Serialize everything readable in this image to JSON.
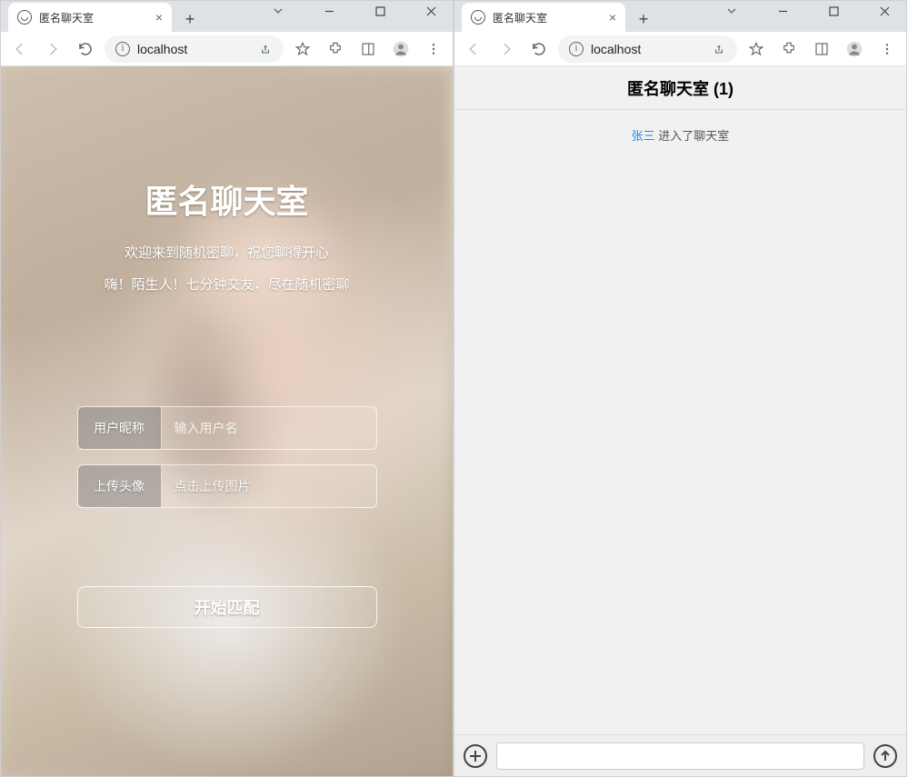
{
  "tab_title": "匿名聊天室",
  "url": "localhost",
  "left": {
    "title": "匿名聊天室",
    "sub1": "欢迎来到随机密聊，祝您聊得开心",
    "sub2": "嗨！陌生人！七分钟交友，尽在随机密聊",
    "nickname_label": "用户昵称",
    "nickname_placeholder": "输入用户名",
    "avatar_label": "上传头像",
    "avatar_placeholder": "点击上传图片",
    "start_button": "开始匹配"
  },
  "right": {
    "header": "匿名聊天室 (1)",
    "sys_user": "张三",
    "sys_text": " 进入了聊天室"
  }
}
